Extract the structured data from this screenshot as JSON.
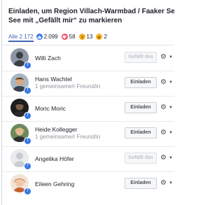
{
  "dialog": {
    "title_line1": "Einladen, um Region Villach-Warmbad / Faaker See / Ossiach",
    "title_line2": "See mit „Gefällt mir“ zu markieren"
  },
  "tabs": {
    "all_label": "Alle 2 172",
    "reactions": [
      {
        "icon": "like-reaction-icon",
        "glyph": "👍",
        "count": "2.099"
      },
      {
        "icon": "love-reaction-icon",
        "glyph": "♥",
        "count": "58"
      },
      {
        "icon": "wow-reaction-icon",
        "glyph": "😮",
        "count": "13"
      },
      {
        "icon": "haha-reaction-icon",
        "glyph": "😆",
        "count": "2"
      }
    ]
  },
  "people": [
    {
      "name": "Willi Zach",
      "subtitle": "",
      "button": "Gefällt das",
      "button_state": "disabled",
      "avatar_color": "#6e7885"
    },
    {
      "name": "Hans Wachtel",
      "subtitle": "1 gemeinsame/r Freund/in",
      "button": "Einladen",
      "button_state": "active",
      "avatar_color": "#8a6a4a"
    },
    {
      "name": "Moric Moric",
      "subtitle": "",
      "button": "Einladen",
      "button_state": "active",
      "avatar_color": "#2c2c2c"
    },
    {
      "name": "Heide Kollegger",
      "subtitle": "1 gemeinsame/r Freund/in",
      "button": "Einladen",
      "button_state": "active",
      "avatar_color": "#c8a060"
    },
    {
      "name": "Angelika Höfer",
      "subtitle": "",
      "button": "Gefällt das",
      "button_state": "disabled",
      "avatar_color": "#e9ebee"
    },
    {
      "name": "Eileen Gehring",
      "subtitle": "",
      "button": "Einladen",
      "button_state": "active",
      "avatar_color": "#c4622d"
    }
  ],
  "icons": {
    "gear": "⚙",
    "caret": "▼",
    "fb_badge": "f"
  }
}
